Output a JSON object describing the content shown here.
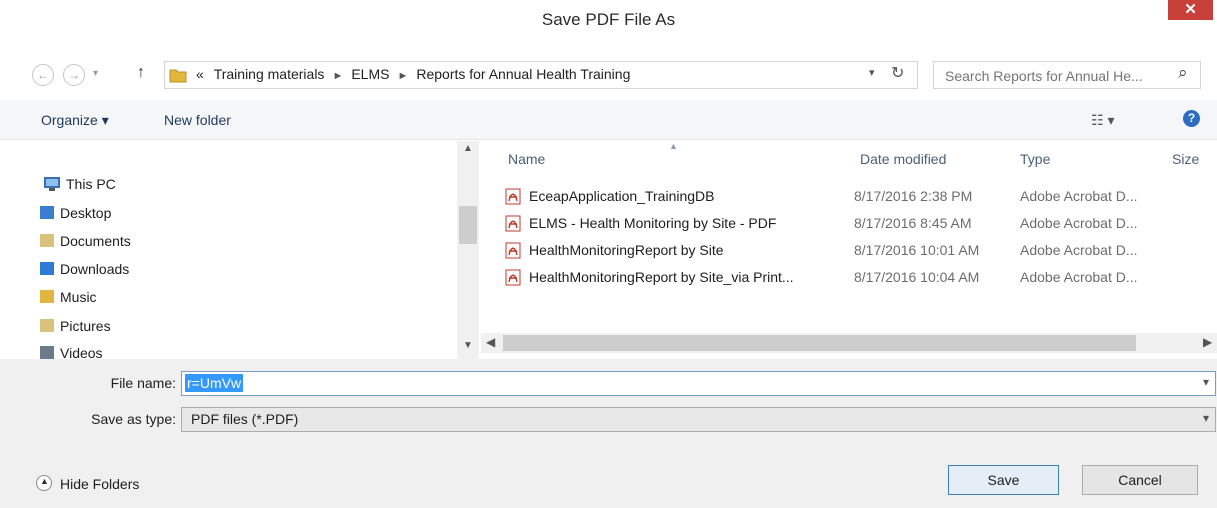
{
  "window": {
    "title": "Save PDF File As",
    "close_glyph": "✕"
  },
  "nav": {
    "back_glyph": "←",
    "forward_glyph": "→",
    "recent_glyph": "▾",
    "up_glyph": "↑",
    "breadcrumb": {
      "overflow": "«",
      "items": [
        "Training materials",
        "ELMS",
        "Reports for Annual Health Training"
      ]
    },
    "refresh_glyph": "↻",
    "search_placeholder": "Search Reports for Annual He...",
    "search_icon": "⌕"
  },
  "toolbar": {
    "organize_label": "Organize ▾",
    "new_folder_label": "New folder",
    "view_glyph": "☷ ▾",
    "help_glyph": "?"
  },
  "nav_pane": {
    "items": [
      {
        "label": "This PC",
        "icon": "computer-icon"
      },
      {
        "label": "Desktop",
        "icon": "desktop-folder-icon"
      },
      {
        "label": "Documents",
        "icon": "documents-folder-icon"
      },
      {
        "label": "Downloads",
        "icon": "downloads-folder-icon"
      },
      {
        "label": "Music",
        "icon": "music-folder-icon"
      },
      {
        "label": "Pictures",
        "icon": "pictures-folder-icon"
      },
      {
        "label": "Videos",
        "icon": "videos-folder-icon"
      }
    ]
  },
  "file_list": {
    "columns": [
      "Name",
      "Date modified",
      "Type",
      "Size"
    ],
    "rows": [
      {
        "name": "EceapApplication_TrainingDB",
        "date": "8/17/2016 2:38 PM",
        "type": "Adobe Acrobat D..."
      },
      {
        "name": "ELMS - Health Monitoring by Site - PDF",
        "date": "8/17/2016 8:45 AM",
        "type": "Adobe Acrobat D..."
      },
      {
        "name": "HealthMonitoringReport by Site",
        "date": "8/17/2016 10:01 AM",
        "type": "Adobe Acrobat D..."
      },
      {
        "name": "HealthMonitoringReport by Site_via Print...",
        "date": "8/17/2016 10:04 AM",
        "type": "Adobe Acrobat D..."
      }
    ]
  },
  "form": {
    "file_name_label": "File name:",
    "file_name_value": "r=UmVw",
    "save_type_label": "Save as type:",
    "save_type_value": "PDF files (*.PDF)",
    "hide_folders_label": "Hide Folders",
    "save_label": "Save",
    "cancel_label": "Cancel"
  },
  "colors": {
    "accent": "#3399ff",
    "close": "#c7403a",
    "pdf": "#c0392b"
  }
}
